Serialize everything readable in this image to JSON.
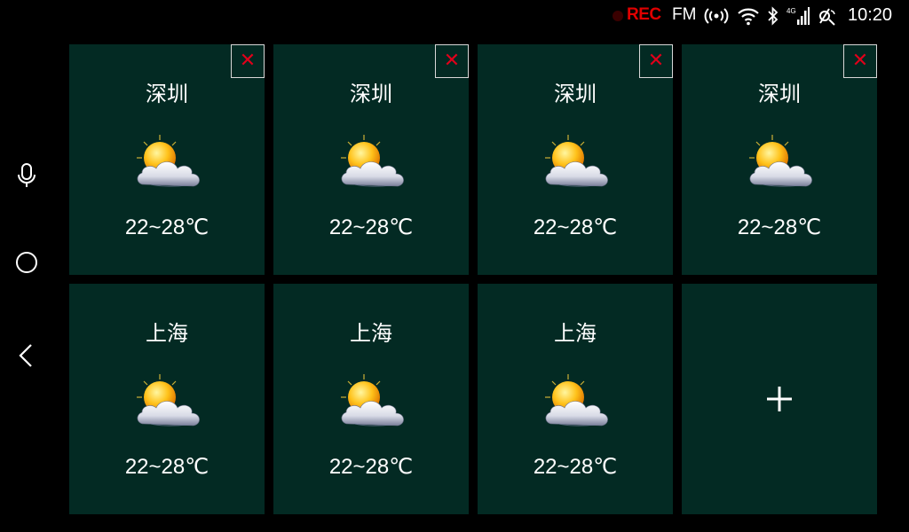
{
  "status_bar": {
    "rec": "REC",
    "radio": "FM",
    "time": "10:20",
    "icons": [
      "rec-dot-icon",
      "broadcast-icon",
      "wifi-icon",
      "bluetooth-icon",
      "signal-4g-icon",
      "satellite-icon"
    ]
  },
  "nav": {
    "icons": [
      "microphone-icon",
      "home-icon",
      "back-icon"
    ]
  },
  "cards": [
    {
      "city": "深圳",
      "temp": "22~28℃",
      "icon": "partly-cloudy-icon",
      "close": "✕"
    },
    {
      "city": "深圳",
      "temp": "22~28℃",
      "icon": "partly-cloudy-icon",
      "close": "✕"
    },
    {
      "city": "深圳",
      "temp": "22~28℃",
      "icon": "partly-cloudy-icon",
      "close": "✕"
    },
    {
      "city": "深圳",
      "temp": "22~28℃",
      "icon": "partly-cloudy-icon",
      "close": "✕"
    },
    {
      "city": "上海",
      "temp": "22~28℃",
      "icon": "partly-cloudy-icon"
    },
    {
      "city": "上海",
      "temp": "22~28℃",
      "icon": "partly-cloudy-icon"
    },
    {
      "city": "上海",
      "temp": "22~28℃",
      "icon": "partly-cloudy-icon"
    }
  ],
  "add_card": {
    "icon": "plus-icon"
  },
  "colors": {
    "background": "#000000",
    "card": "#032a23",
    "rec": "#e00000",
    "close": "#e0001a"
  }
}
